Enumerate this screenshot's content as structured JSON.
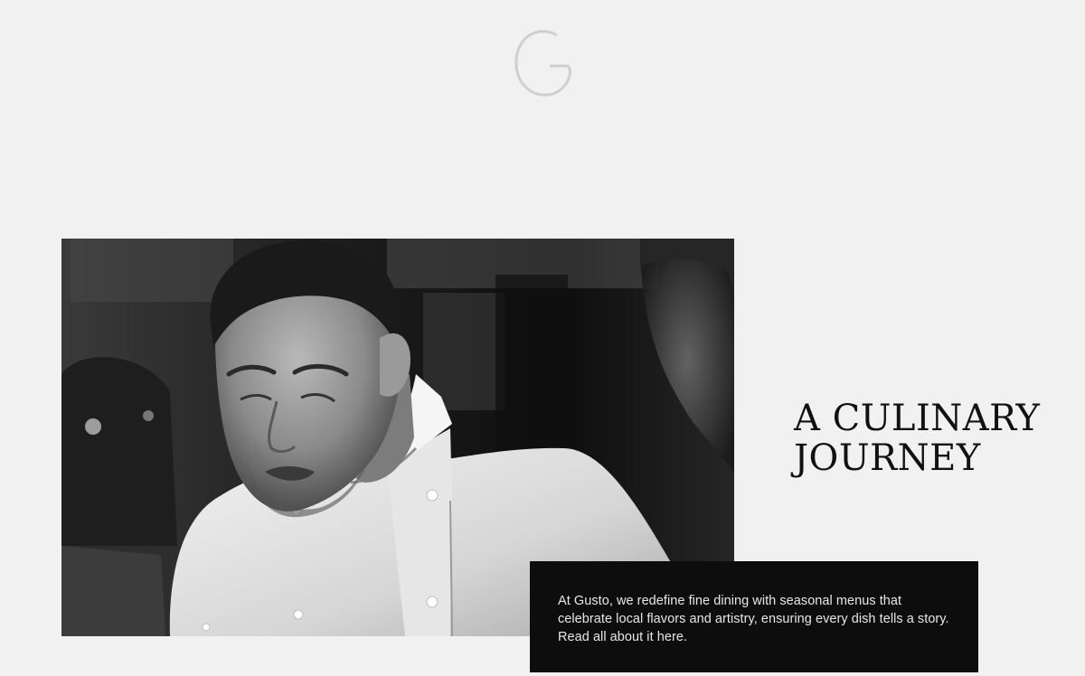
{
  "brand": {
    "logo_icon": "gusto-g-logo-icon"
  },
  "hero": {
    "image_icon": "chef-photo",
    "headline_line1": "A Culinary",
    "headline_line2": "Journey"
  },
  "story": {
    "text_line1": "At Gusto, we redefine fine dining with seasonal menus that",
    "text_line2": "celebrate local flavors and artistry, ensuring every dish tells a story.",
    "link_text": "Read all about it here."
  },
  "colors": {
    "background": "#f1f1f1",
    "card": "#0d0d0d",
    "card_text": "#e7e7e7",
    "headline": "#111111",
    "logo": "#cfcfcf"
  }
}
